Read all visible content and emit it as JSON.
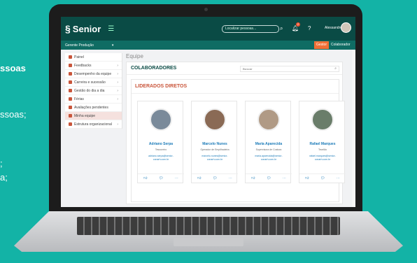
{
  "background": {
    "lines": [
      "ssoas",
      "ssoas;",
      ";",
      "a;"
    ]
  },
  "colors": {
    "background": "#13b3a6",
    "topbar": "#0a4b45",
    "accent": "#c9553a",
    "gestor_button": "#f06f35",
    "link": "#1a7ab8"
  },
  "app": {
    "logo": "Senior",
    "search_placeholder": "Localizar pessoas...",
    "notification_count": "2",
    "username": "Alessandro",
    "subbar_title": "Gerente Produção",
    "gestor_label": "Gestor",
    "colaborador_label": "Colaborador"
  },
  "sidebar": {
    "items": [
      {
        "label": "Painel"
      },
      {
        "label": "Feedbacks"
      },
      {
        "label": "Desempenho da equipe"
      },
      {
        "label": "Carreira e sucessão"
      },
      {
        "label": "Gestão do dia a dia"
      },
      {
        "label": "Férias"
      },
      {
        "label": "Avaliações pendentes"
      },
      {
        "label": "Minha equipe"
      },
      {
        "label": "Estrutura organizacional"
      }
    ]
  },
  "main": {
    "page_title": "Equipe",
    "section_title": "COLABORADORES",
    "search_placeholder": "Buscar",
    "leaders_title": "LIDERADOS DIRETOS",
    "cards": [
      {
        "name": "Adriano Serpa",
        "role": "Tesoureiro",
        "email": "adriano.serpa@senior-conarh.com.br",
        "photo_color": "#7a8a9a"
      },
      {
        "name": "Marcelo Nunes",
        "role": "Operador de Empilhadeira",
        "email": "marcelo.nunes@senior-conarh.com.br",
        "photo_color": "#8a6a55"
      },
      {
        "name": "Maria Aparecida",
        "role": "Supervisora de Costura",
        "email": "maria.aparecida@senior-conarh.com.br",
        "photo_color": "#b09a85"
      },
      {
        "name": "Rafael Marques",
        "role": "Tecelão",
        "email": "rafael.marques@senior-conarh.com.br",
        "photo_color": "#6a7d6a"
      }
    ],
    "action_icons": [
      "thumbs-up-icon",
      "chat-icon",
      "more-icon"
    ]
  }
}
